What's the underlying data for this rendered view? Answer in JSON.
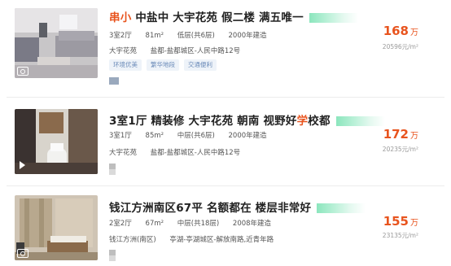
{
  "listings": [
    {
      "title_highlight": "串小",
      "title": "中盐中 大宇花苑 假二楼 满五唯一",
      "layout": "3室2厅",
      "area": "81m²",
      "floor": "低层(共6层)",
      "built": "2000年建造",
      "community": "大宇花苑",
      "address": "盐都-盐都城区-人民中路12号",
      "tags": [
        "环境优美",
        "繁华地段",
        "交通便利"
      ],
      "price": "168",
      "price_unit": "万",
      "unit_price": "20596元/m²"
    },
    {
      "title": "3室1厅 精装修 大宇花苑 朝南 视野好",
      "title_highlight_tail": "学",
      "title_tail": "校都",
      "layout": "3室1厅",
      "area": "85m²",
      "floor": "中层(共6层)",
      "built": "2000年建造",
      "community": "大宇花苑",
      "address": "盐都-盐都城区-人民中路12号",
      "price": "172",
      "price_unit": "万",
      "unit_price": "20235元/m²"
    },
    {
      "title": "钱江方洲南区67平 名额都在 楼层非常好",
      "layout": "2室2厅",
      "area": "67m²",
      "floor": "中层(共18层)",
      "built": "2008年建造",
      "community": "钱江方洲(南区)",
      "address": "亭湖-亭湖城区-解放南路,近青年路",
      "price": "155",
      "price_unit": "万",
      "unit_price": "23135元/m²"
    }
  ]
}
